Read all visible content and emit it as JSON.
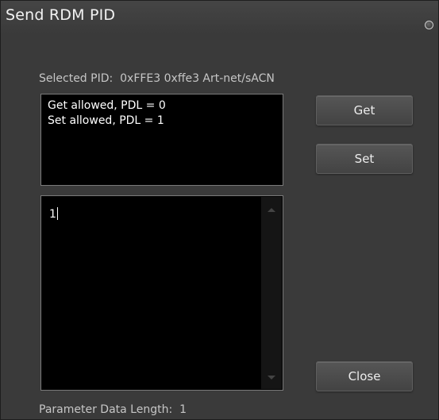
{
  "window": {
    "title": "Send RDM PID"
  },
  "selected_pid": {
    "label": "Selected PID:",
    "value": "0xFFE3 0xffe3 Art-net/sACN"
  },
  "info_lines": [
    "Get allowed, PDL = 0",
    "Set allowed, PDL = 1"
  ],
  "data_input": {
    "value": "1"
  },
  "buttons": {
    "get_label": "Get",
    "set_label": "Set",
    "close_label": "Close"
  },
  "parameter_data_length": {
    "label": "Parameter Data Length:",
    "value": "1"
  },
  "colors": {
    "window_bg": "#3a3a3a",
    "box_bg": "#000000",
    "text": "#ffffff",
    "label_text": "#c6c6c6"
  },
  "icons": {
    "title_button": "close-icon",
    "scroll_up": "scroll-up-arrow-icon",
    "scroll_down": "scroll-down-arrow-icon"
  }
}
